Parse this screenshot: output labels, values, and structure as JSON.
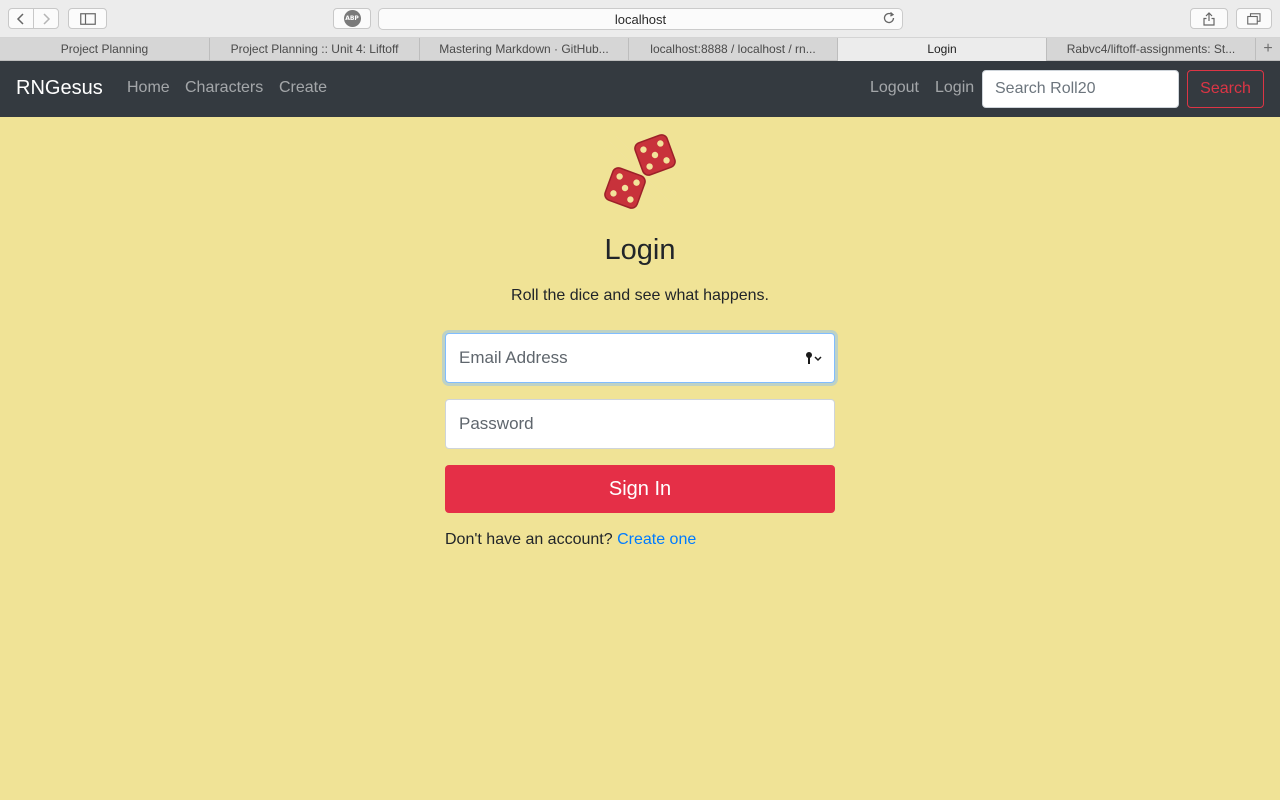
{
  "browser": {
    "url": "localhost",
    "adblock_label": "ABP",
    "tabs": [
      {
        "label": "Project Planning",
        "active": false
      },
      {
        "label": "Project Planning :: Unit 4: Liftoff",
        "active": false
      },
      {
        "label": "Mastering Markdown · GitHub...",
        "active": false
      },
      {
        "label": "localhost:8888 / localhost / rn...",
        "active": false
      },
      {
        "label": "Login",
        "active": true
      },
      {
        "label": "Rabvc4/liftoff-assignments: St...",
        "active": false
      }
    ],
    "new_tab_label": "+"
  },
  "navbar": {
    "brand": "RNGesus",
    "links": [
      "Home",
      "Characters",
      "Create"
    ],
    "right_links": [
      "Logout",
      "Login"
    ],
    "search_placeholder": "Search Roll20",
    "search_button": "Search"
  },
  "login": {
    "logo_icon": "dice-icon",
    "title": "Login",
    "subtitle": "Roll the dice and see what happens.",
    "email_placeholder": "Email Address",
    "password_placeholder": "Password",
    "submit_label": "Sign In",
    "register_prompt": "Don't have an account?",
    "register_link": "Create one"
  },
  "colors": {
    "page_background": "#f0e396",
    "navbar": "#343a40",
    "primary_button": "#e52f47",
    "search_accent": "#dc3545",
    "link": "#007bff",
    "dice": "#c8323b"
  }
}
